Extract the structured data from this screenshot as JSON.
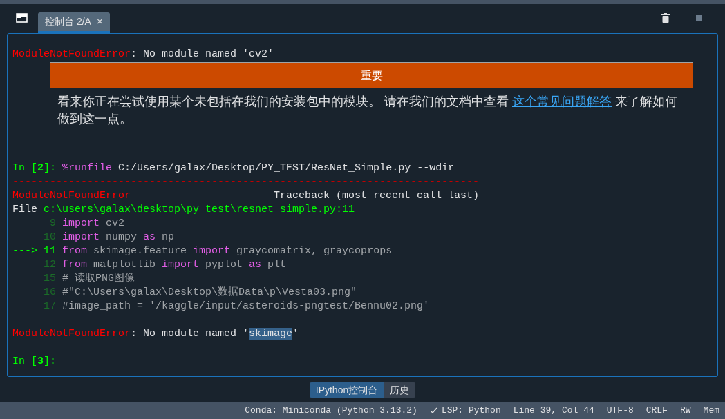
{
  "tabs": [
    {
      "label": "控制台 2/A",
      "selected": true,
      "close": "×"
    }
  ],
  "console": [
    {
      "kind": "blank"
    },
    {
      "kind": "line",
      "segments": [
        {
          "text": "ModuleNotFoundError",
          "kind": "error"
        },
        {
          "text": ": No module named 'cv2'",
          "kind": "plain"
        }
      ]
    },
    {
      "kind": "notice",
      "title": "重要",
      "body": [
        {
          "text": "看来你正在尝试使用某个未包括在我们的安装包中的模块。 请在我们的文档中查看 ",
          "kind": "plain"
        },
        {
          "text": "这个常见问题解答",
          "kind": "link"
        },
        {
          "text": " 来了解如何做到这一点。",
          "kind": "plain"
        }
      ]
    },
    {
      "kind": "blank"
    },
    {
      "kind": "blank"
    },
    {
      "kind": "line",
      "segments": [
        {
          "text": "In [",
          "kind": "prompt"
        },
        {
          "text": "2",
          "kind": "prompt_num"
        },
        {
          "text": "]: ",
          "kind": "prompt"
        },
        {
          "text": "%runfile",
          "kind": "keyword"
        },
        {
          "text": " C:/Users/galax/Desktop/PY_TEST/ResNet_Simple.py --wdir",
          "kind": "plain"
        }
      ]
    },
    {
      "kind": "line",
      "segments": [
        {
          "text": "---------------------------------------------------------------------------",
          "kind": "rule"
        }
      ]
    },
    {
      "kind": "line",
      "segments": [
        {
          "text": "ModuleNotFoundError",
          "kind": "error"
        },
        {
          "text": "                       Traceback (most recent call last)",
          "kind": "plain"
        }
      ]
    },
    {
      "kind": "line",
      "segments": [
        {
          "text": "File ",
          "kind": "plain"
        },
        {
          "text": "c:\\users\\galax\\desktop\\py_test\\resnet_simple.py:11",
          "kind": "path"
        }
      ]
    },
    {
      "kind": "line",
      "segments": [
        {
          "text": "      9",
          "kind": "lineno"
        },
        {
          "text": "import",
          "kind": "keyword"
        },
        {
          "text": " cv2",
          "kind": "code"
        }
      ]
    },
    {
      "kind": "line",
      "segments": [
        {
          "text": "     10",
          "kind": "lineno"
        },
        {
          "text": "import",
          "kind": "keyword"
        },
        {
          "text": " numpy ",
          "kind": "code"
        },
        {
          "text": "as",
          "kind": "keyword"
        },
        {
          "text": " np",
          "kind": "code"
        }
      ]
    },
    {
      "kind": "line",
      "segments": [
        {
          "text": "--->",
          "kind": "arrow"
        },
        {
          "text": "11",
          "kind": "current_lineno"
        },
        {
          "text": "from",
          "kind": "keyword"
        },
        {
          "text": " skimage.feature ",
          "kind": "code"
        },
        {
          "text": "import",
          "kind": "keyword"
        },
        {
          "text": " graycomatrix, graycoprops",
          "kind": "code"
        }
      ]
    },
    {
      "kind": "line",
      "segments": [
        {
          "text": "     12",
          "kind": "lineno"
        },
        {
          "text": "from",
          "kind": "keyword"
        },
        {
          "text": " matplotlib ",
          "kind": "code"
        },
        {
          "text": "import",
          "kind": "keyword"
        },
        {
          "text": " pyplot ",
          "kind": "code"
        },
        {
          "text": "as",
          "kind": "keyword"
        },
        {
          "text": " plt",
          "kind": "code"
        }
      ]
    },
    {
      "kind": "line",
      "segments": [
        {
          "text": "     15",
          "kind": "lineno"
        },
        {
          "text": "# 读取PNG图像",
          "kind": "code"
        }
      ]
    },
    {
      "kind": "line",
      "segments": [
        {
          "text": "     16",
          "kind": "lineno"
        },
        {
          "text": "#\"C:\\Users\\galax\\Desktop\\数据Data\\p\\Vesta03.png\"",
          "kind": "code"
        }
      ]
    },
    {
      "kind": "line",
      "segments": [
        {
          "text": "     17",
          "kind": "lineno"
        },
        {
          "text": "#image_path = '/kaggle/input/asteroids-pngtest/Bennu02.png'",
          "kind": "code"
        }
      ]
    },
    {
      "kind": "blank"
    },
    {
      "kind": "line",
      "segments": [
        {
          "text": "ModuleNotFoundError",
          "kind": "error"
        },
        {
          "text": ": No module named '",
          "kind": "plain"
        },
        {
          "text": "skimage",
          "kind": "selected"
        },
        {
          "text": "'",
          "kind": "plain"
        }
      ]
    },
    {
      "kind": "blank"
    },
    {
      "kind": "line",
      "segments": [
        {
          "text": "In [",
          "kind": "prompt"
        },
        {
          "text": "3",
          "kind": "prompt_num"
        },
        {
          "text": "]:",
          "kind": "prompt"
        }
      ]
    }
  ],
  "bottom_tabs": [
    {
      "label": "IPython控制台",
      "selected": true
    },
    {
      "label": "历史",
      "selected": false
    }
  ],
  "status_bar": [
    {
      "text": "Conda: Miniconda (Python 3.13.2)",
      "check": false
    },
    {
      "text": "LSP: Python",
      "check": true
    },
    {
      "text": "Line 39, Col 44",
      "check": false
    },
    {
      "text": "UTF-8",
      "check": false
    },
    {
      "text": "CRLF",
      "check": false
    },
    {
      "text": "RW",
      "check": false
    },
    {
      "text": "Mem",
      "check": false
    }
  ]
}
